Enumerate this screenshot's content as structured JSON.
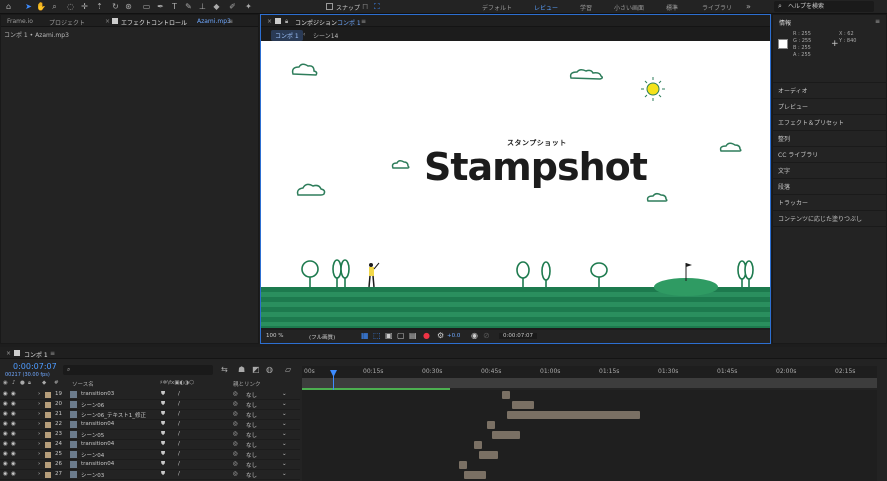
{
  "workspaces": [
    "デフォルト",
    "レビュー",
    "学習",
    "小さい画面",
    "標準",
    "ライブラリ"
  ],
  "snap_label": "スナップ",
  "help_placeholder": "ヘルプを検索",
  "left_panel": {
    "tabs": [
      "Frame.io",
      "プロジェクト",
      "エフェクトコントロール"
    ],
    "tab_suffix": "Azami.mp3",
    "subtitle": "コンポ 1 • Azami.mp3"
  },
  "comp_panel": {
    "tab_prefix": "コンポジション",
    "tab_name": "コンポ 1",
    "crumbs": [
      "コンポ 1",
      "シーン14"
    ]
  },
  "canvas": {
    "title": "Stampshot",
    "title_ruby": "スタンプショット",
    "sky_color": "#ffffff",
    "ground_color": "#1d7a4e",
    "sun_color": "#f5e21b",
    "golfer_color": "#f2d84a"
  },
  "viewer_bar": {
    "zoom": "100 %",
    "quality": "(フル画質)",
    "exposure": "+0.0",
    "timecode": "0:00:07:07"
  },
  "info_panel": {
    "title": "情報",
    "rgba": [
      {
        "k": "R",
        "v": "255"
      },
      {
        "k": "G",
        "v": "255"
      },
      {
        "k": "B",
        "v": "255"
      },
      {
        "k": "A",
        "v": "255"
      }
    ],
    "x": "X : 62",
    "y": "Y : 840"
  },
  "right_panels": [
    "オーディオ",
    "プレビュー",
    "エフェクト＆プリセット",
    "整列",
    "CC ライブラリ",
    "文字",
    "段落",
    "トラッカー",
    "コンテンツに応じた塗りつぶし"
  ],
  "timeline": {
    "tab": "コンポ 1",
    "timecode": "0:00:07:07",
    "fps": "00217 (30.00 fps)",
    "col_source": "ソース名",
    "col_parent": "親とリンク",
    "ruler": [
      "00s",
      "00:15s",
      "00:30s",
      "00:45s",
      "01:00s",
      "01:15s",
      "01:30s",
      "01:45s",
      "02:00s",
      "02:15s"
    ],
    "layers": [
      {
        "num": "19",
        "name": "transition03",
        "parent": "なし",
        "bar_start": 0.79,
        "bar_len": 0.02
      },
      {
        "num": "20",
        "name": "シーン06",
        "parent": "なし",
        "bar_start": 0.83,
        "bar_len": 0.07
      },
      {
        "num": "21",
        "name": "シーン06_テキスト1_修正",
        "parent": "なし",
        "bar_start": 0.81,
        "bar_len": 0.42
      },
      {
        "num": "22",
        "name": "transition04",
        "parent": "なし",
        "bar_start": 0.73,
        "bar_len": 0.02
      },
      {
        "num": "23",
        "name": "シーン05",
        "parent": "なし",
        "bar_start": 0.75,
        "bar_len": 0.09
      },
      {
        "num": "24",
        "name": "transition04",
        "parent": "なし",
        "bar_start": 0.68,
        "bar_len": 0.02
      },
      {
        "num": "25",
        "name": "シーン04",
        "parent": "なし",
        "bar_start": 0.7,
        "bar_len": 0.06
      },
      {
        "num": "26",
        "name": "transition04",
        "parent": "なし",
        "bar_start": 0.62,
        "bar_len": 0.02
      },
      {
        "num": "27",
        "name": "シーン03",
        "parent": "なし",
        "bar_start": 0.64,
        "bar_len": 0.07
      }
    ]
  }
}
